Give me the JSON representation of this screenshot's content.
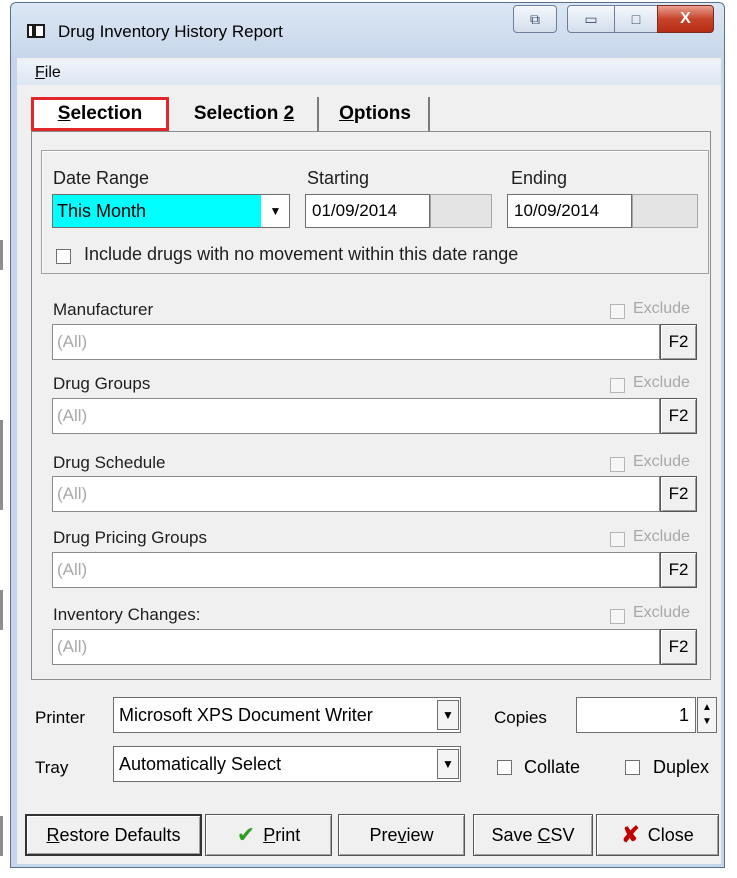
{
  "window": {
    "title": "Drug Inventory History Report",
    "restore_glyph": "⧉",
    "minimize_glyph": "▭",
    "maximize_glyph": "□",
    "close_glyph": "X"
  },
  "menu": {
    "file_first": "F",
    "file_rest": "ile"
  },
  "tabs": {
    "selection_first": "S",
    "selection_rest": "election",
    "selection2_text": "Selection ",
    "selection2_ul": "2",
    "options_first": "O",
    "options_rest": "ptions"
  },
  "date": {
    "range_label": "Date Range",
    "range_value": "This Month",
    "starting_label": "Starting",
    "start_date": "01/09/2014",
    "ending_label": "Ending",
    "end_date": "10/09/2014",
    "include_label": "Include drugs with no movement within this date range"
  },
  "filters": [
    {
      "label": "Manufacturer",
      "value": "(All)",
      "exclude": "Exclude",
      "button": "F2"
    },
    {
      "label": "Drug Groups",
      "value": "(All)",
      "exclude": "Exclude",
      "button": "F2"
    },
    {
      "label": "Drug Schedule",
      "value": "(All)",
      "exclude": "Exclude",
      "button": "F2"
    },
    {
      "label": "Drug Pricing Groups",
      "value": "(All)",
      "exclude": "Exclude",
      "button": "F2"
    },
    {
      "label": "Inventory Changes:",
      "value": "(All)",
      "exclude": "Exclude",
      "button": "F2"
    }
  ],
  "print": {
    "printer_label": "Printer",
    "printer_value": "Microsoft XPS Document Writer",
    "copies_label": "Copies",
    "copies_value": "1",
    "tray_label": "Tray",
    "tray_value": "Automatically Select",
    "collate_label": "Collate",
    "duplex_label": "Duplex"
  },
  "buttons": {
    "restore_first": "R",
    "restore_rest": "estore Defaults",
    "print_first": "P",
    "print_rest": "rint",
    "preview_a": "Pre",
    "preview_ul": "v",
    "preview_b": "iew",
    "save_a": "Save ",
    "save_ul": "C",
    "save_b": "SV",
    "close_label": "Close"
  },
  "icons": {
    "dropdown": "▼",
    "spin_up": "▲",
    "spin_down": "▼",
    "check_mark": "✔",
    "close_x": "✘"
  },
  "colors": {
    "selected_value_bg": "#00ffff",
    "active_tab_border": "#e0272c",
    "close_icon": "#c00000",
    "print_check": "#2a9d22"
  }
}
